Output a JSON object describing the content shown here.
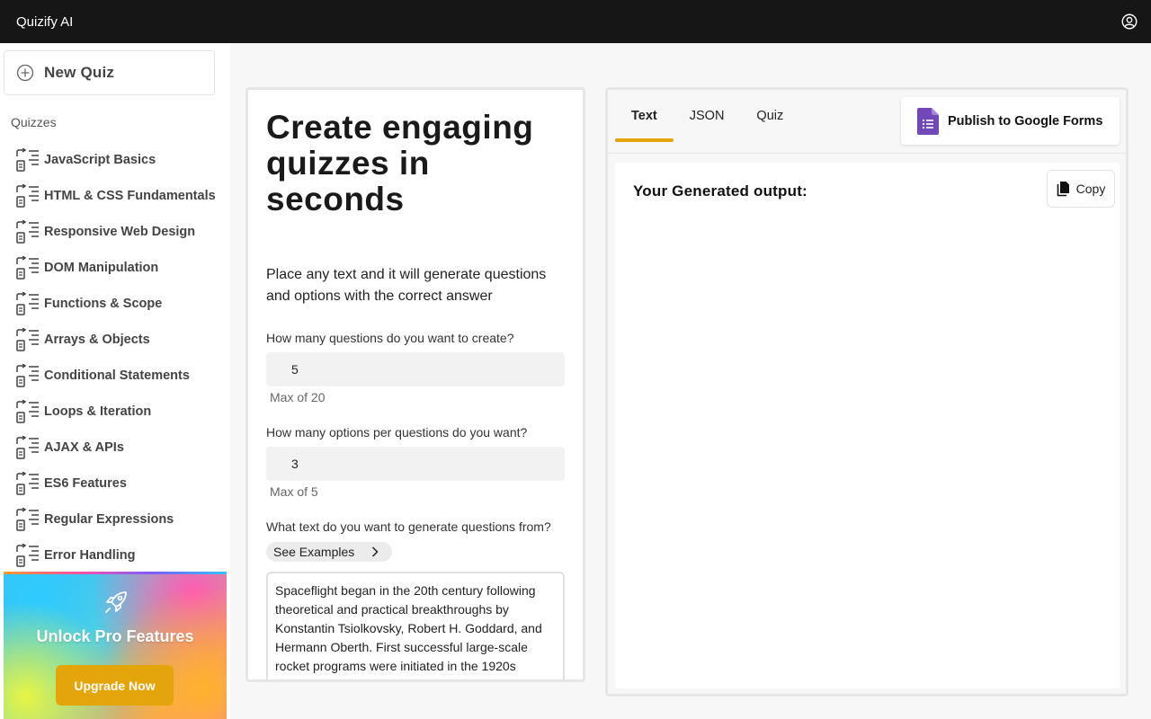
{
  "app": {
    "title": "Quizify AI"
  },
  "header": {
    "account_icon": "user-circle-icon"
  },
  "sidebar": {
    "new_quiz_label": "New Quiz",
    "new_quiz_icon": "plus-circle-icon",
    "section_label": "Quizzes",
    "item_icon": "quiz-list-icon",
    "items": [
      {
        "label": "JavaScript Basics"
      },
      {
        "label": "HTML & CSS Fundamentals"
      },
      {
        "label": "Responsive Web Design"
      },
      {
        "label": "DOM Manipulation"
      },
      {
        "label": "Functions & Scope"
      },
      {
        "label": "Arrays & Objects"
      },
      {
        "label": "Conditional Statements"
      },
      {
        "label": "Loops & Iteration"
      },
      {
        "label": "AJAX & APIs"
      },
      {
        "label": "ES6 Features"
      },
      {
        "label": "Regular Expressions"
      },
      {
        "label": "Error Handling"
      }
    ],
    "promo": {
      "icon": "rocket-icon",
      "title": "Unlock Pro Features",
      "button_label": "Upgrade Now",
      "button_color": "#e4a50a"
    }
  },
  "form": {
    "headline": "Create engaging quizzes in seconds",
    "subline": "Place any text and it will generate questions and options with the correct answer",
    "questions_label": "How many questions do you want to create?",
    "questions_value": "5",
    "questions_hint": "Max of 20",
    "options_label": "How many options per questions do you want?",
    "options_value": "3",
    "options_hint": "Max of 5",
    "text_label": "What text do you want to generate questions from?",
    "see_examples_label": "See Examples",
    "source_text": "Spaceflight began in the 20th century following theoretical and practical breakthroughs by Konstantin Tsiolkovsky, Robert H. Goddard, and Hermann Oberth. First successful large-scale rocket programs were initiated in the 1920s Germany by Fritz von Opel and Max Valier, and"
  },
  "output": {
    "tabs": [
      {
        "label": "Text",
        "active": true
      },
      {
        "label": "JSON",
        "active": false
      },
      {
        "label": "Quiz",
        "active": false
      }
    ],
    "publish_label": "Publish to Google Forms",
    "publish_icon": "google-forms-icon",
    "title": "Your Generated output:",
    "copy_label": "Copy",
    "copy_icon": "copy-icon",
    "accent_color": "#e4a50a"
  }
}
